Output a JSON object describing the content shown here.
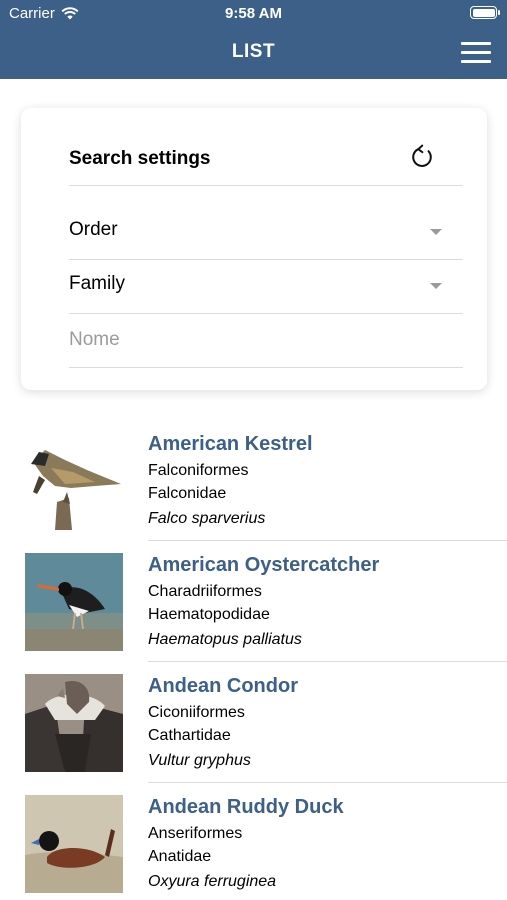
{
  "status_bar": {
    "carrier": "Carrier",
    "time": "9:58 AM"
  },
  "header": {
    "title": "LIST",
    "menu_icon": "hamburger-menu-icon"
  },
  "search": {
    "title": "Search settings",
    "refresh_icon": "refresh-icon",
    "order_label": "Order",
    "family_label": "Family",
    "name_placeholder": "Nome",
    "name_value": ""
  },
  "birds": [
    {
      "name": "American Kestrel",
      "order": "Falconiformes",
      "family": "Falconidae",
      "scientific": "Falco sparverius"
    },
    {
      "name": "American Oystercatcher",
      "order": "Charadriiformes",
      "family": "Haematopodidae",
      "scientific": "Haematopus palliatus"
    },
    {
      "name": "Andean Condor",
      "order": "Ciconiiformes",
      "family": "Cathartidae",
      "scientific": "Vultur gryphus"
    },
    {
      "name": "Andean Ruddy Duck",
      "order": "Anseriformes",
      "family": "Anatidae",
      "scientific": "Oxyura ferruginea"
    }
  ],
  "colors": {
    "header": "#3c6088",
    "bird_name": "#3c6088",
    "divider": "#dcdcdc"
  }
}
